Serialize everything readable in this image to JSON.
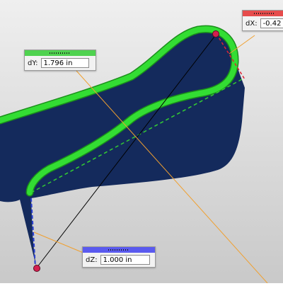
{
  "colors": {
    "background_top": "#efefef",
    "background_bottom": "#c9c9c9",
    "part_body": "#142a5c",
    "highlight_edge": "#33dd33",
    "highlight_edge_dark": "#1b8f1b",
    "leader_line": "#f0a030",
    "dy_accent": "#4fd24f",
    "dx_accent": "#e64c4c",
    "dz_accent": "#5a5aef",
    "measure_point": "#d42050"
  },
  "dimensions": {
    "dy": {
      "label": "dY:",
      "value": "1.796 in"
    },
    "dx": {
      "label": "dX:",
      "value": "-0.42"
    },
    "dz": {
      "label": "dZ:",
      "value": "1.000 in"
    }
  }
}
